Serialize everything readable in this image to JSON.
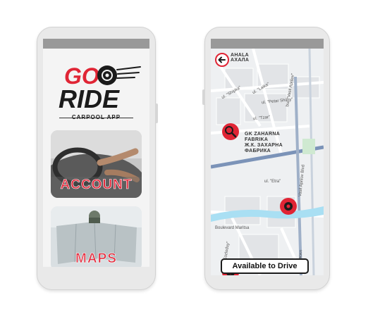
{
  "left_phone": {
    "logo": {
      "word_go": "GO",
      "word_ride": "RIDE",
      "tagline": "CARPOOL APP"
    },
    "cards": {
      "account_label": "ACCOUNT",
      "maps_label": "MAPS"
    }
  },
  "right_phone": {
    "map_labels": {
      "top_place_line1": "AHALA",
      "top_place_line2": "AXAЛA",
      "street_shipka": "ul. \"Shipka\"",
      "street_laika": "ul. \"Laika\"",
      "street_petar_shiloy": "ul. \"Petar Shiloy\"",
      "street_tzar": "ul. \"Tzar\"",
      "street_etra": "ul. \"Etra\"",
      "district_line1": "GK ZAHARNA",
      "district_line2": "FABRIKA",
      "district_line3": "Ж.К. ЗАХАРНА",
      "district_line4": "ФАБРИКА",
      "vasil_aprilov_top": "bul. \"Vasil Aprilov\"",
      "vasil_aprilov_blvd": "Vasil Aprilov Blvd",
      "boulevard_maritsa": "Boulevard Maritsa",
      "street_kozloduy": "ul. \"Kozloduy\"",
      "bul_vasil": "бул. \"Васил"
    },
    "available_button_label": "Available to Drive"
  },
  "colors": {
    "brand_red": "#e02535",
    "phone_body": "#e9e9e9",
    "topbar": "#999999",
    "road_blue": "#7b93b8",
    "river": "#a9dff3"
  },
  "icons": {
    "back": "arrow-left-circle-icon",
    "search_marker": "search-icon",
    "wheel_marker": "wheel-icon"
  }
}
